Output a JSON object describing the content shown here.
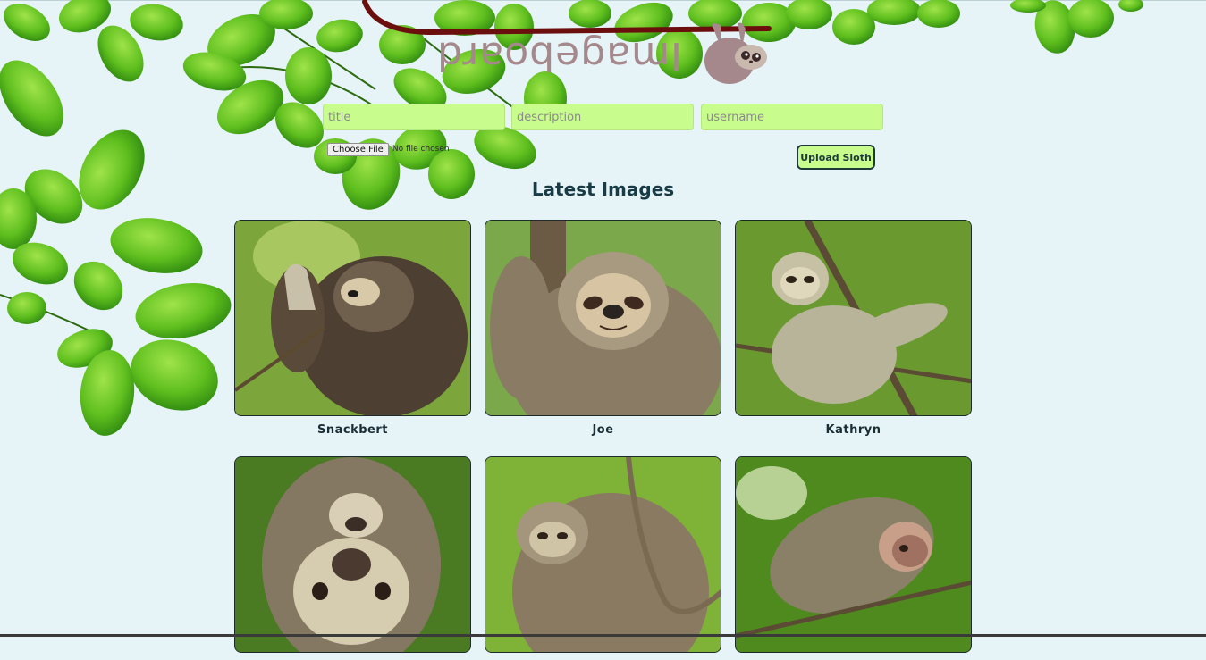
{
  "header": {
    "logo_text": "Imageboard"
  },
  "form": {
    "title_placeholder": "title",
    "description_placeholder": "description",
    "username_placeholder": "username",
    "choose_file_label": "Choose File",
    "no_file_text": "No file chosen",
    "upload_label": "Upload Sloth"
  },
  "gallery": {
    "heading": "Latest Images",
    "images": [
      {
        "title": "Snackbert"
      },
      {
        "title": "Joe"
      },
      {
        "title": "Kathryn"
      },
      {
        "title": ""
      },
      {
        "title": ""
      },
      {
        "title": ""
      }
    ]
  },
  "colors": {
    "page_background": "#e6f3f7",
    "input_background": "#c8fc8d",
    "heading_color": "#183b45",
    "logo_color": "#a4888b",
    "vine_color": "#6b0e0e"
  }
}
